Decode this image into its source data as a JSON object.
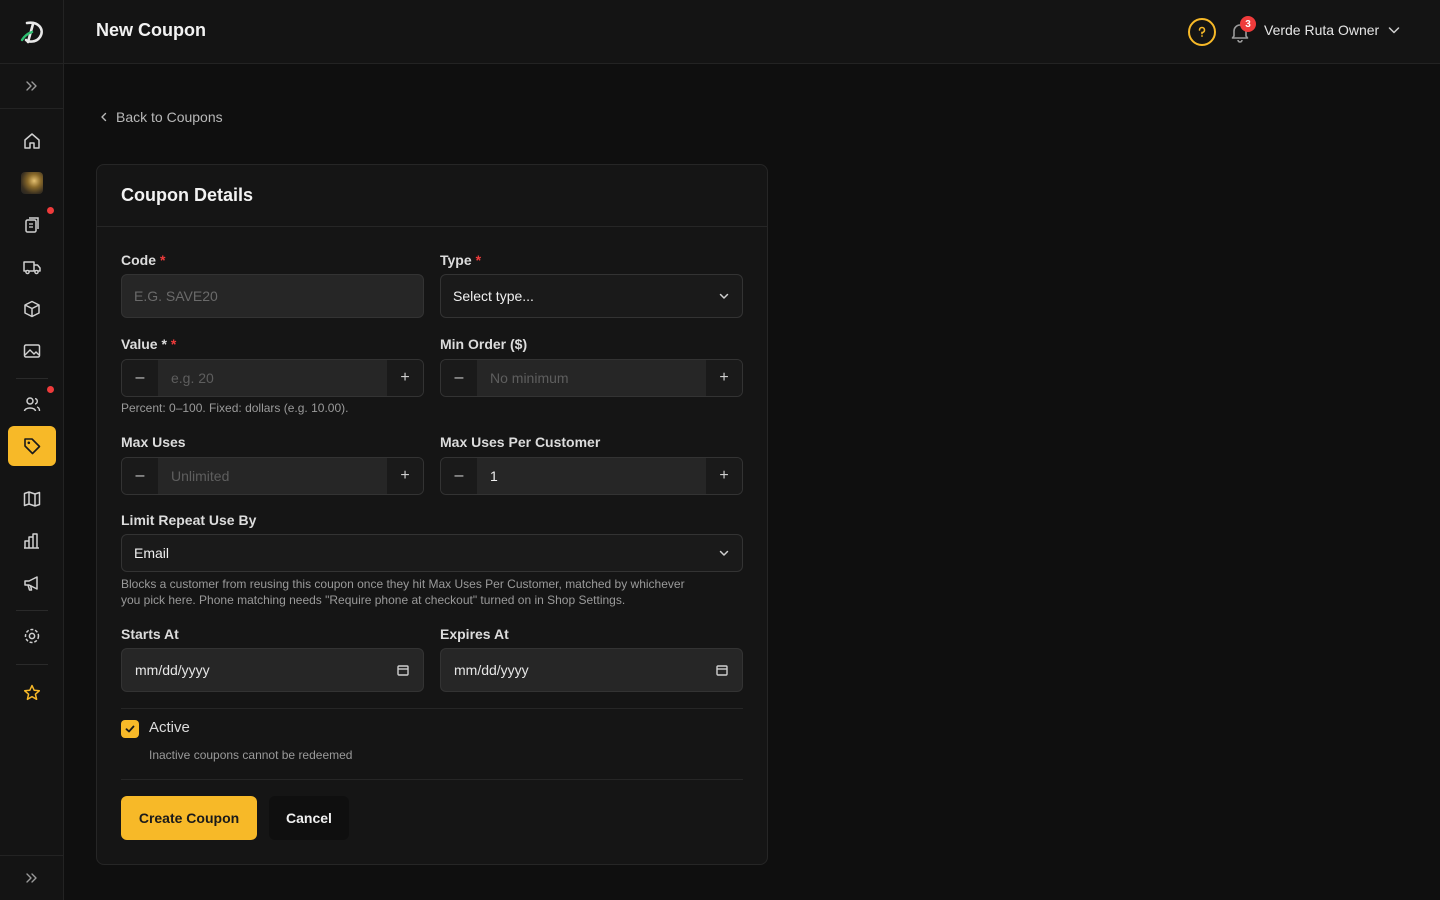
{
  "header": {
    "title": "New Coupon",
    "notification_count": "3",
    "user_name": "Verde Ruta Owner"
  },
  "back_link": "Back to Coupons",
  "card": {
    "title": "Coupon Details",
    "code": {
      "label": "Code",
      "required": "*",
      "placeholder": "E.G. SAVE20"
    },
    "type": {
      "label": "Type",
      "required": "*",
      "value": "Select type..."
    },
    "value": {
      "label": "Value *",
      "required": "*",
      "placeholder": "e.g. 20",
      "hint": "Percent: 0–100. Fixed: dollars (e.g. 10.00)."
    },
    "min_order": {
      "label": "Min Order ($)",
      "placeholder": "No minimum"
    },
    "max_uses": {
      "label": "Max Uses",
      "placeholder": "Unlimited"
    },
    "max_uses_per_customer": {
      "label": "Max Uses Per Customer",
      "value": "1"
    },
    "limit_repeat": {
      "label": "Limit Repeat Use By",
      "value": "Email",
      "hint_line1": "Blocks a customer from reusing this coupon once they hit Max Uses Per Customer, matched by whichever",
      "hint_line2": "you pick here. Phone matching needs \"Require phone at checkout\" turned on in Shop Settings."
    },
    "starts_at": {
      "label": "Starts At",
      "value": "mm/dd/yyyy"
    },
    "expires_at": {
      "label": "Expires At",
      "value": "mm/dd/yyyy"
    },
    "active": {
      "label": "Active",
      "checked": true,
      "hint": "Inactive coupons cannot be redeemed"
    },
    "create_label": "Create Coupon",
    "cancel_label": "Cancel"
  },
  "colors": {
    "accent": "#f7b928",
    "danger": "#ef3b3b",
    "background": "#0f0f0f",
    "surface": "#151515"
  },
  "sidebar_icons": [
    "chevrons-right-icon",
    "home-icon",
    "brand-image-icon",
    "orders-icon",
    "truck-icon",
    "box-icon",
    "image-icon",
    "customers-icon",
    "tag-icon",
    "book-icon",
    "analytics-icon",
    "megaphone-icon",
    "settings-icon",
    "star-icon",
    "chevrons-right-icon"
  ]
}
